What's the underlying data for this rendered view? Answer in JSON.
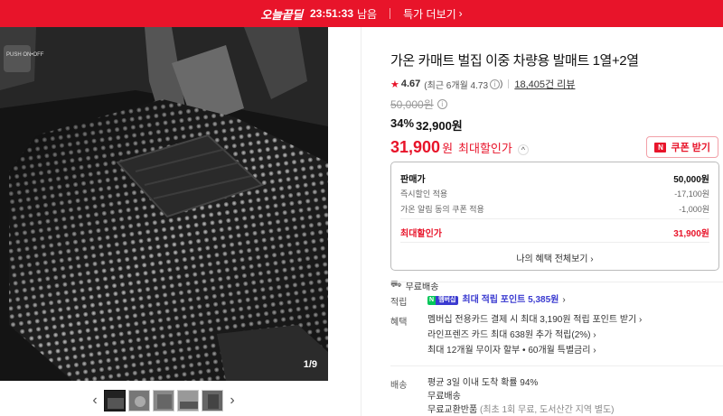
{
  "banner": {
    "brand": "오늘끝딜",
    "timer": "23:51:33",
    "timer_suffix": "남음",
    "more_label": "특가 더보기"
  },
  "gallery": {
    "counter": "1/9",
    "button_label": "PUSH ON•OFF",
    "thumb_count": 5
  },
  "product": {
    "title": "가온 카매트 벌집 이중 차량용 발매트 1열+2열",
    "rating": "4.67",
    "rating_recent": "(최근 6개월 4.73",
    "rating_recent_close": ")",
    "review_count": "18,405건 리뷰",
    "original_price": "50,000원",
    "discount_rate": "34%",
    "discount_price": "32,900원",
    "max_price": "31,900",
    "max_unit": "원",
    "max_label": "최대할인가",
    "coupon_label": "쿠폰 받기"
  },
  "price_box": {
    "rows": [
      {
        "label": "판매가",
        "value": "50,000원"
      },
      {
        "label": "즉시할인 적용",
        "value": "-17,100원"
      },
      {
        "label": "가온 알림 동의 쿠폰 적용",
        "value": "-1,000원"
      }
    ],
    "max_label": "최대할인가",
    "max_value": "31,900원",
    "benefit_link": "나의 혜택 전체보기"
  },
  "shipping_short": "무료배송",
  "details": {
    "points_label": "적립",
    "points_badge_n": "N",
    "points_badge_pay": "멤버십",
    "points_text": "최대 적립 포인트 5,385원",
    "benefit_label": "혜택",
    "benefits": [
      "멤버십 전용카드 결제 시 최대 3,190원 적립 포인트 받기",
      "라인프렌즈 카드 최대 638원 추가 적립(2%)",
      "최대 12개월 무이자 할부 • 60개월 특별금리"
    ],
    "delivery_label": "배송",
    "delivery": [
      "평균 3일 이내 도착 확률 94%",
      "무료배송",
      "무료교환반품"
    ],
    "delivery_note": "(최초 1회 무료, 도서산간 지역 별도)"
  },
  "colors": {
    "accent": "#e8142a",
    "point": "#3a3ad0",
    "npay": "#03c75a"
  }
}
